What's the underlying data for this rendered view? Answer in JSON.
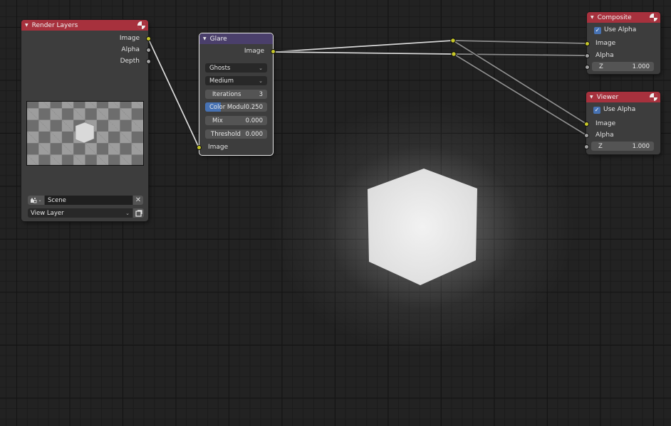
{
  "editor": "Compositor Node Editor",
  "colors": {
    "header_output": "#a7313d",
    "header_filter": "#4a3f6b",
    "socket_color": "#c7c729",
    "socket_float": "#a1a1a1",
    "slider_fill": "#4772b3"
  },
  "nodes": {
    "render_layers": {
      "title": "Render Layers",
      "icon": "render-result-icon",
      "outputs": [
        "Image",
        "Alpha",
        "Depth"
      ],
      "scene_label": "Scene",
      "scene_icon": "scene-icon",
      "view_layer_label": "View Layer",
      "preview": "checkerboard-with-cube"
    },
    "glare": {
      "title": "Glare",
      "output": "Image",
      "glare_type": "Ghosts",
      "quality": "Medium",
      "fields": [
        {
          "label": "Iterations",
          "value": "3"
        },
        {
          "label": "Color Modul",
          "value": "0.250",
          "fill_fraction": 0.25
        },
        {
          "label": "Mix",
          "value": "0.000"
        },
        {
          "label": "Threshold",
          "value": "0.000"
        }
      ],
      "input": "Image"
    },
    "composite": {
      "title": "Composite",
      "icon": "render-result-icon",
      "use_alpha_label": "Use Alpha",
      "use_alpha": true,
      "inputs": [
        "Image",
        "Alpha"
      ],
      "z_label": "Z",
      "z_value": "1.000"
    },
    "viewer": {
      "title": "Viewer",
      "icon": "render-result-icon",
      "use_alpha_label": "Use Alpha",
      "use_alpha": true,
      "inputs": [
        "Image",
        "Alpha"
      ],
      "z_label": "Z",
      "z_value": "1.000"
    }
  },
  "links": [
    {
      "from": "Render Layers.Image",
      "to": "Glare.Image"
    },
    {
      "from": "Glare.Image",
      "to": "Reroute A"
    },
    {
      "from": "Glare.Image",
      "to": "Reroute B"
    },
    {
      "from": "Reroute A",
      "to": "Composite.Image"
    },
    {
      "from": "Reroute A",
      "to": "Viewer.Image"
    },
    {
      "from": "Reroute B",
      "to": "Composite.Alpha"
    },
    {
      "from": "Reroute B",
      "to": "Viewer.Alpha"
    }
  ],
  "backdrop": "glowing-cube-render"
}
